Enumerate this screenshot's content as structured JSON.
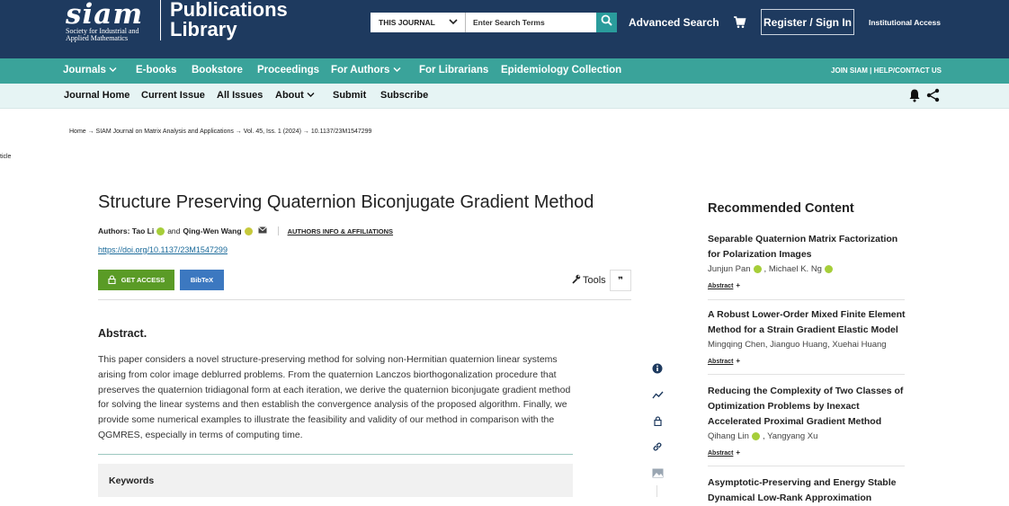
{
  "header": {
    "logo_word": "siam",
    "logo_sub_line1": "Society for Industrial and",
    "logo_sub_line2": "Applied Mathematics",
    "pub_title_line1": "Publications",
    "pub_title_line2": "Library",
    "search_scope": "THIS JOURNAL",
    "search_placeholder": "Enter Search Terms",
    "advanced_search": "Advanced Search",
    "register": "Register / Sign In",
    "institutional": "Institutional Access",
    "icons": [
      "search-icon",
      "cart-icon",
      "chevron-down-icon"
    ]
  },
  "main_nav": {
    "items": [
      "Journals",
      "E-books",
      "Bookstore",
      "Proceedings",
      "For Authors",
      "For Librarians",
      "Epidemiology Collection"
    ],
    "right": "JOIN SIAM | HELP/CONTACT US"
  },
  "journal_nav": {
    "items": [
      "Journal Home",
      "Current Issue",
      "All Issues",
      "About",
      "Submit",
      "Subscribe"
    ],
    "icons": [
      "bell-icon",
      "share-icon"
    ]
  },
  "breadcrumb": "Home → SIAM Journal on Matrix Analysis and Applications → Vol. 45, Iss. 1 (2024) → 10.1137/23M1547299",
  "cut_label": "ticle",
  "article": {
    "title": "Structure Preserving Quaternion Biconjugate Gradient Method",
    "authors_label": "Authors",
    "author1": "Tao Li",
    "and": "and",
    "author2": "Qing-Wen Wang",
    "authors_info": "AUTHORS INFO & AFFILIATIONS",
    "doi": "https://doi.org/10.1137/23M1547299",
    "get_access": "GET ACCESS",
    "bibtex": "BibTeX",
    "tools": "Tools",
    "abstract_heading": "Abstract.",
    "abstract_text": "This paper considers a novel structure-preserving method for solving non-Hermitian quaternion linear systems arising from color image deblurred problems. From the quaternion Lanczos biorthogonalization procedure that preserves the quaternion tridiagonal form at each iteration, we derive the quaternion biconjugate gradient method for solving the linear systems and then establish the convergence analysis of the proposed algorithm. Finally, we provide some numerical examples to illustrate the feasibility and validity of our method in comparison with the QGMRES, especially in terms of computing time.",
    "keywords": "Keywords"
  },
  "side_icons": [
    "info-icon",
    "metrics-icon",
    "lock-icon",
    "link-icon",
    "image-icon"
  ],
  "recommended": {
    "heading": "Recommended Content",
    "abstract_link": "Abstract",
    "items": [
      {
        "title": "Separable Quaternion Matrix Factorization for Polarization Images",
        "authors": [
          "Junjun Pan",
          "Michael K. Ng"
        ]
      },
      {
        "title": "A Robust Lower-Order Mixed Finite Element Method for a Strain Gradient Elastic Model",
        "authors": [
          "Mingqing Chen, Jianguo Huang, Xuehai Huang"
        ]
      },
      {
        "title": "Reducing the Complexity of Two Classes of Optimization Problems by Inexact Accelerated Proximal Gradient Method",
        "authors": [
          "Qihang Lin",
          "Yangyang Xu"
        ]
      },
      {
        "title": "Asymptotic-Preserving and Energy Stable Dynamical Low-Rank Approximation",
        "authors": []
      }
    ]
  },
  "colors": {
    "header_bg": "#1e3a5f",
    "nav_teal": "#3aa39a",
    "subnav_bg": "#e6f4f4",
    "access_green": "#5a9b26",
    "bibtex_blue": "#3c78c0",
    "orcid_green": "#a6ce39"
  }
}
